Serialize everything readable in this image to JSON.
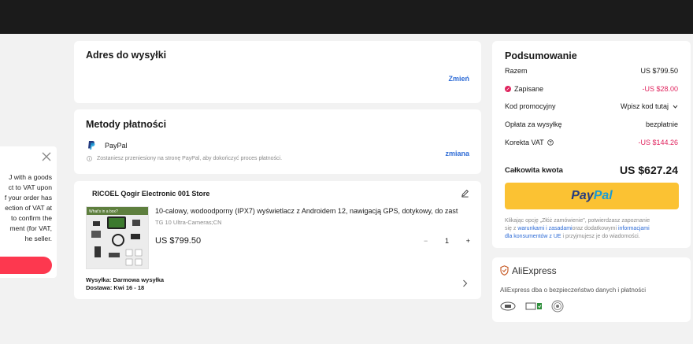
{
  "colors": {
    "topbar": "#1b1b1b",
    "accent_red": "#e0245e",
    "link_blue": "#2d6bd6",
    "paypal_yellow": "#fbc233",
    "popup_button": "#fd384f"
  },
  "popup": {
    "lines": [
      "J with a goods",
      "ct to VAT upon",
      "f your order has",
      "ection of VAT at",
      "to confirm the",
      "ment (for VAT,",
      "he seller."
    ],
    "close_icon": "close-icon"
  },
  "shipping": {
    "title": "Adres do wysyłki",
    "change_label": "Zmień"
  },
  "payment": {
    "title": "Metody płatności",
    "method_name": "PayPal",
    "method_icon": "paypal-logo-icon",
    "change_label": "zmiana",
    "redirect_note": "Zostaniesz przeniesiony na stronę PayPal, aby dokończyć proces płatności.",
    "info_icon": "info-icon"
  },
  "store": {
    "name": "RICOEL Qogir Electronic 001 Store",
    "edit_icon": "edit-icon",
    "product": {
      "image_caption": "What's in a box?",
      "title": "10-calowy, wodoodporny (IPX7) wyświetlacz z Androidem 12, nawigacją GPS, dotykowy, do zast",
      "variant": "TG 10 Ultra-Cameras;CN",
      "price": "US $799.50",
      "quantity": "1",
      "minus": "−",
      "plus": "+"
    },
    "shipping_label": "Wysyłka: Darmowa wysyłka",
    "delivery_label": "Dostawa: Kwi 16 - 18",
    "chevron_icon": "chevron-right-icon"
  },
  "summary": {
    "title": "Podsumowanie",
    "rows": [
      {
        "label": "Razem",
        "value": "US $799.50"
      },
      {
        "label": "Zapisane",
        "value": "-US $28.00"
      },
      {
        "label": "Kod promocyjny",
        "value": "Wpisz kod tutaj"
      },
      {
        "label": "Opłata za wysyłkę",
        "value": "bezpłatnie"
      },
      {
        "label": "Korekta VAT",
        "value": "-US $144.26"
      }
    ],
    "total_label": "Całkowita kwota",
    "total_value": "US $627.24",
    "paypal_button": {
      "a": "Pay",
      "b": "Pal"
    },
    "terms_1": "Klikając opcję „Złóż zamówienie\", potwierdzasz zapoznanie",
    "terms_2a": "się z",
    "terms_2_link1": "warunkami i zasadami",
    "terms_2b": "oraz dodatkowymi",
    "terms_2_link2": "informacjami",
    "terms_3_link": "dla konsumentów z UE",
    "terms_3b": "i przyjmujesz je do wiadomości."
  },
  "trust": {
    "brand": "AliExpress",
    "description": "AliExpress dba o bezpieczeństwo danych i płatności",
    "badges": [
      "security-badge-icon",
      "verified-badge-icon",
      "certificate-badge-icon"
    ]
  }
}
